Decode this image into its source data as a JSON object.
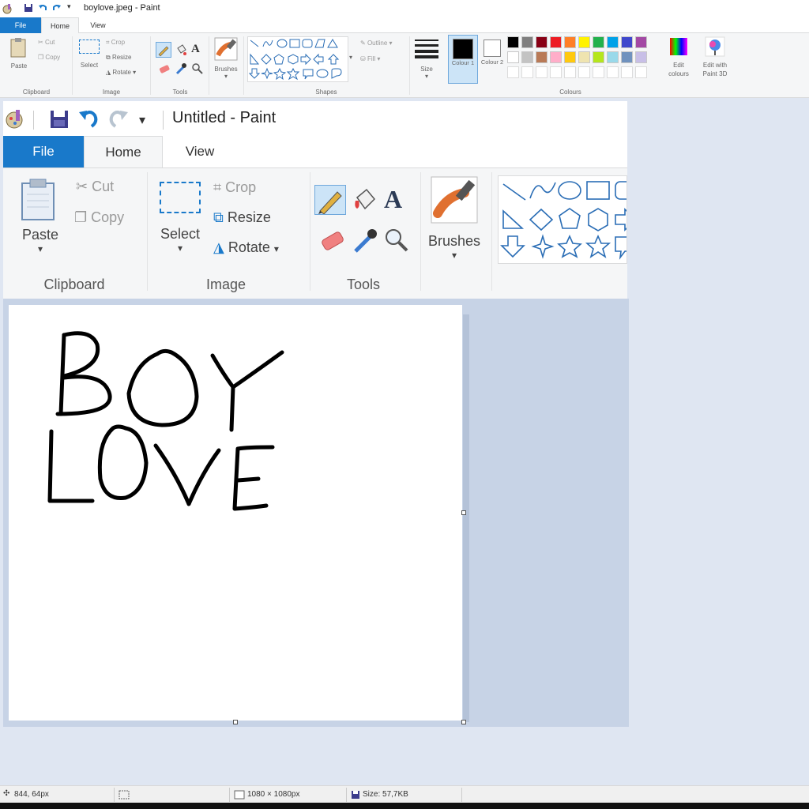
{
  "outer": {
    "title": "boylove.jpeg - Paint",
    "tabs": {
      "file": "File",
      "home": "Home",
      "view": "View"
    },
    "clipboard": {
      "paste": "Paste",
      "cut": "Cut",
      "copy": "Copy",
      "group": "Clipboard"
    },
    "image": {
      "select": "Select",
      "crop": "Crop",
      "resize": "Resize",
      "rotate": "Rotate",
      "group": "Image"
    },
    "tools": {
      "group": "Tools"
    },
    "brushes": "Brushes",
    "shapes": {
      "outline": "Outline",
      "fill": "Fill",
      "group": "Shapes"
    },
    "size": "Size",
    "colour1": "Colour 1",
    "colour2": "Colour 2",
    "colours_group": "Colours",
    "edit_colours": "Edit colours",
    "edit_3d": "Edit with Paint 3D",
    "palette_row1": [
      "#000000",
      "#7f7f7f",
      "#880015",
      "#ed1c24",
      "#ff7f27",
      "#fff200",
      "#22b14c",
      "#00a2e8",
      "#3f48cc",
      "#a349a4"
    ],
    "palette_row2": [
      "#ffffff",
      "#c3c3c3",
      "#b97a57",
      "#ffaec9",
      "#ffc90e",
      "#efe4b0",
      "#b5e61d",
      "#99d9ea",
      "#7092be",
      "#c8bfe7"
    ]
  },
  "inner": {
    "title": "Untitled - Paint",
    "tabs": {
      "file": "File",
      "home": "Home",
      "view": "View"
    },
    "paste": "Paste",
    "cut": "Cut",
    "copy": "Copy",
    "select": "Select",
    "crop": "Crop",
    "resize": "Resize",
    "rotate": "Rotate",
    "brushes": "Brushes",
    "groups": {
      "clipboard": "Clipboard",
      "image": "Image",
      "tools": "Tools"
    }
  },
  "status": {
    "cursor": "844, 64px",
    "dimensions": "1080 × 1080px",
    "size": "Size: 57,7KB"
  },
  "colors": {
    "accent": "#1979ca",
    "canvas_bg": "#c7d3e6"
  }
}
